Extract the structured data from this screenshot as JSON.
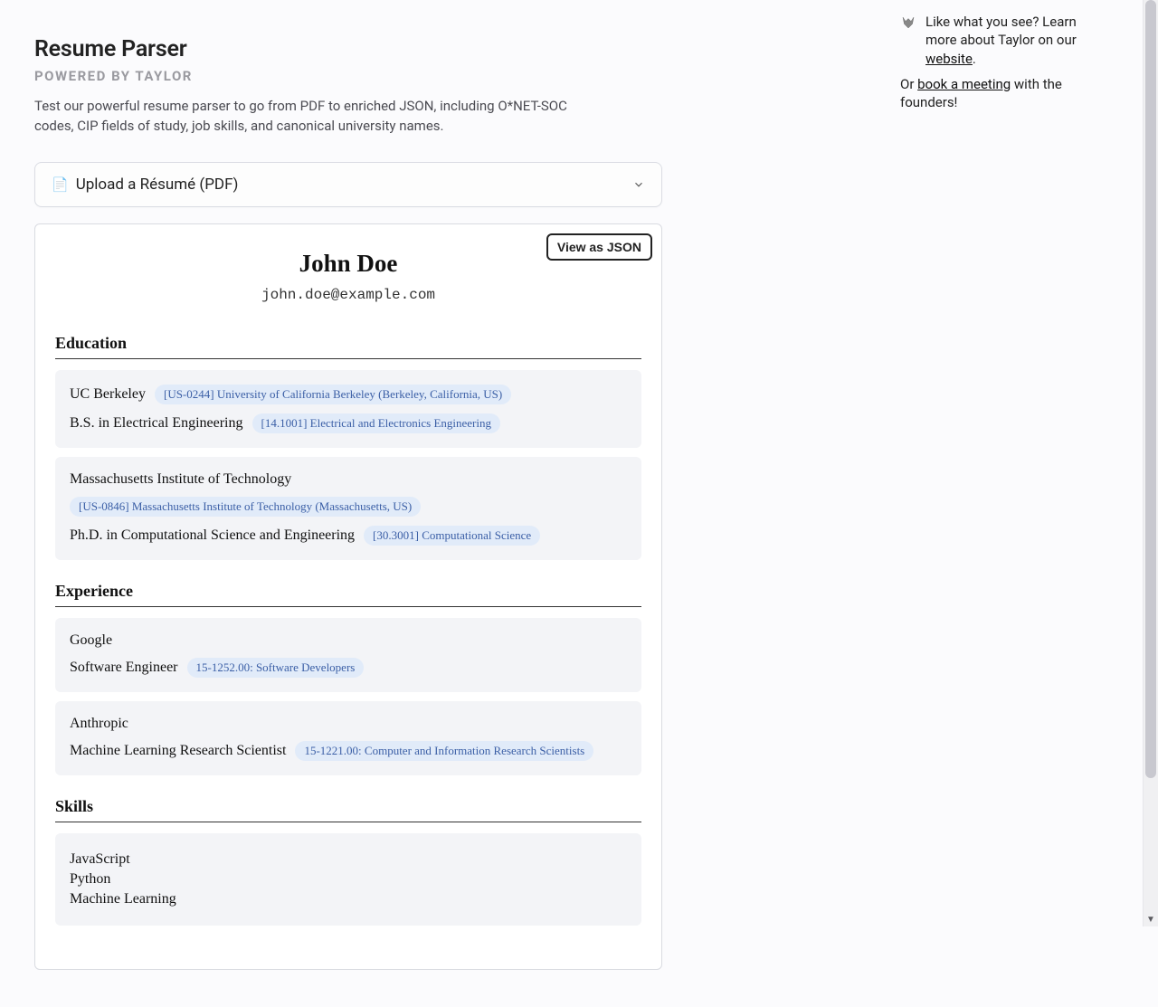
{
  "header": {
    "title": "Resume Parser",
    "subtitle": "POWERED BY TAYLOR",
    "intro": "Test our powerful resume parser to go from PDF to enriched JSON, including O*NET-SOC codes, CIP fields of study, job skills, and canonical university names."
  },
  "upload": {
    "icon": "📄",
    "label": "Upload a Résumé (PDF)"
  },
  "json_button": "View as JSON",
  "resume": {
    "name": "John Doe",
    "email": "john.doe@example.com",
    "education_heading": "Education",
    "education": [
      {
        "school": "UC Berkeley",
        "school_tag": "[US-0244] University of California Berkeley (Berkeley, California, US)",
        "degree": "B.S. in Electrical Engineering",
        "degree_tag": "[14.1001] Electrical and Electronics Engineering"
      },
      {
        "school": "Massachusetts Institute of Technology",
        "school_tag": "[US-0846] Massachusetts Institute of Technology (Massachusetts, US)",
        "degree": "Ph.D. in Computational Science and Engineering",
        "degree_tag": "[30.3001] Computational Science"
      }
    ],
    "experience_heading": "Experience",
    "experience": [
      {
        "company": "Google",
        "title": "Software Engineer",
        "title_tag": "15-1252.00: Software Developers"
      },
      {
        "company": "Anthropic",
        "title": "Machine Learning Research Scientist",
        "title_tag": "15-1221.00: Computer and Information Research Scientists"
      }
    ],
    "skills_heading": "Skills",
    "skills": [
      "JavaScript",
      "Python",
      "Machine Learning"
    ]
  },
  "sidebar": {
    "line1_pre": "Like what you see? Learn more about Taylor on our ",
    "website_link": "website",
    "line1_post": ".",
    "line2_pre": "Or ",
    "meeting_link": "book a meeting",
    "line2_post": " with the founders!"
  }
}
